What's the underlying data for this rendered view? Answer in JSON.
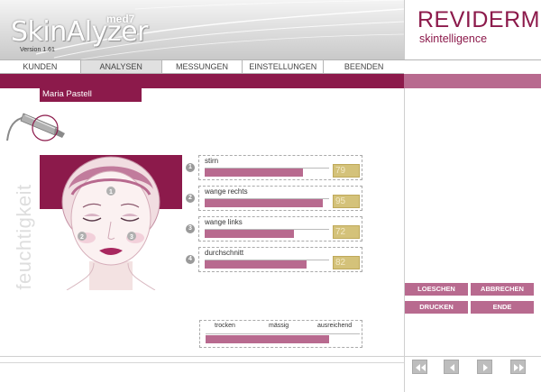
{
  "app": {
    "name": "SkinAlyzer",
    "suffix": "med7",
    "version": "Version 1.61"
  },
  "brand": {
    "name": "REVIDERM",
    "tagline": "skintelligence"
  },
  "nav": {
    "items": [
      "KUNDEN",
      "ANALYSEN",
      "MESSUNGEN",
      "EINSTELLUNGEN",
      "BEENDEN"
    ],
    "active": "ANALYSEN"
  },
  "patient": {
    "name": "Maria   Pastell"
  },
  "section_label": "feuchtigkeit",
  "measurements": [
    {
      "num": "1",
      "label": "stirn",
      "value": "79"
    },
    {
      "num": "2",
      "label": "wange rechts",
      "value": "95"
    },
    {
      "num": "3",
      "label": "wange links",
      "value": "72"
    },
    {
      "num": "4",
      "label": "durchschnitt",
      "value": "82"
    }
  ],
  "scale": {
    "labels": [
      "trocken",
      "mässig",
      "ausreichend"
    ],
    "level": 0.8
  },
  "face_markers": [
    "1",
    "2",
    "3"
  ],
  "actions": {
    "delete": "LOESCHEN",
    "cancel": "ABBRECHEN",
    "print": "DRUCKEN",
    "end": "ENDE"
  },
  "colors": {
    "brand": "#8c1a4b",
    "accent": "#b86a8f",
    "value_box": "#d4c27a"
  },
  "icons": {
    "probe": "measurement-probe-icon",
    "first": "first-page-icon",
    "prev": "previous-page-icon",
    "next": "next-page-icon",
    "last": "last-page-icon"
  }
}
